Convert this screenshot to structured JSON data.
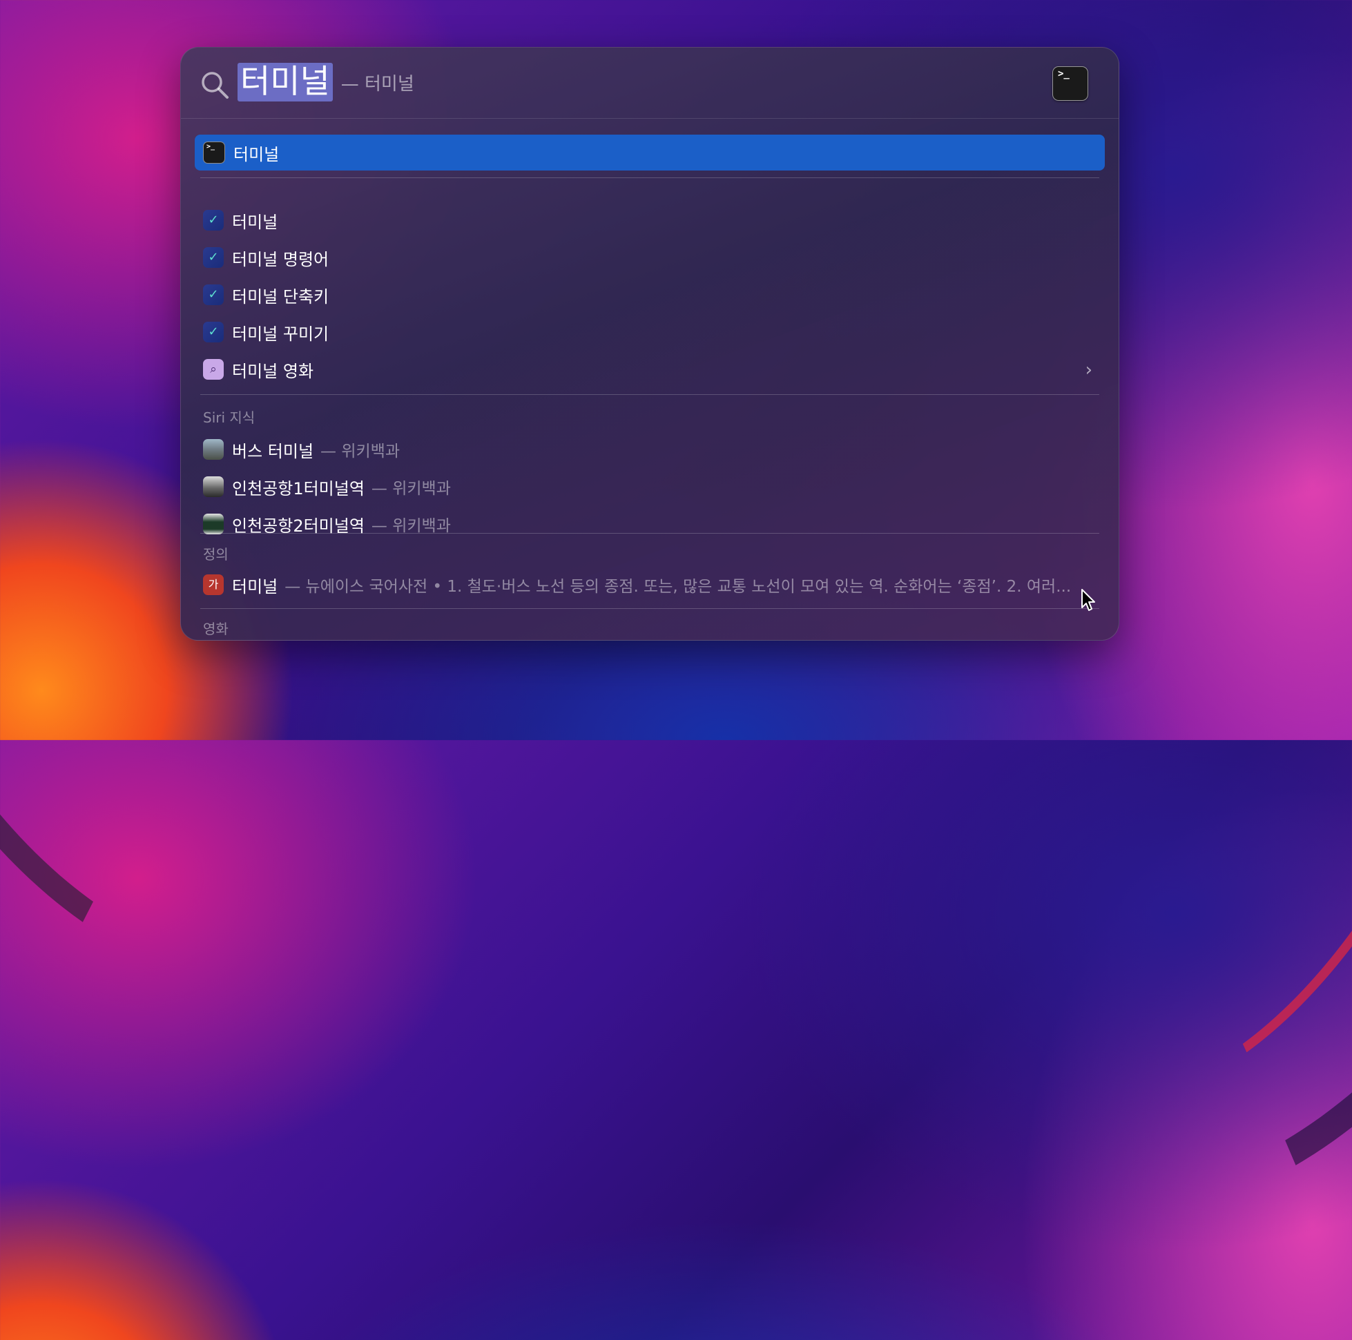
{
  "search": {
    "query": "터미널",
    "completion": "— 터미널",
    "preview_prompt": ">_"
  },
  "top_hit": {
    "label": "터미널",
    "icon_text": ">_"
  },
  "suggestions": [
    {
      "label": "터미널",
      "icon": "bird-icon"
    },
    {
      "label": "터미널 명령어",
      "icon": "bird-icon"
    },
    {
      "label": "터미널 단축키",
      "icon": "bird-icon"
    },
    {
      "label": "터미널 꾸미기",
      "icon": "bird-icon"
    },
    {
      "label": "터미널 영화",
      "icon": "search-web-icon"
    }
  ],
  "siri_knowledge": {
    "header": "Siri 지식",
    "items": [
      {
        "title": "버스 터미널",
        "source": "— 위키백과"
      },
      {
        "title": "인천공항1터미널역",
        "source": "— 위키백과"
      },
      {
        "title": "인천공항2터미널역",
        "source": "— 위키백과"
      }
    ]
  },
  "definition": {
    "header": "정의",
    "title": "터미널",
    "icon_text": "가",
    "text": "— 뉴에이스 국어사전 • 1. 철도·버스 노선 등의 종점. 또는, 많은 교통 노선이 모여 있는 역. 순화어는 ‘종점’. 2. 여러..."
  },
  "movies": {
    "header": "영화"
  },
  "colors": {
    "selection": "#1b5fc8",
    "query_highlight": "#7882e6"
  }
}
